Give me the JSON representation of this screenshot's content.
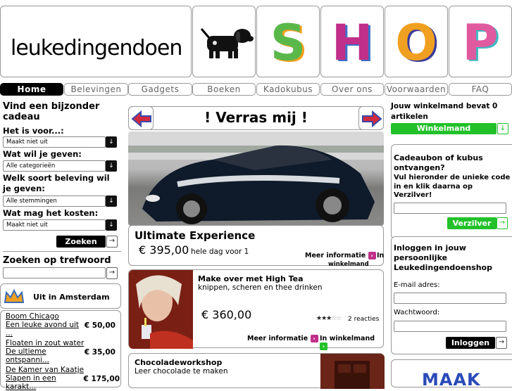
{
  "header": {
    "logo_text": "leukedingendoen",
    "shop_letters": [
      {
        "letter": "S",
        "color": "#5ab84a"
      },
      {
        "letter": "H",
        "color": "#c0308a"
      },
      {
        "letter": "O",
        "color": "#f0a020"
      },
      {
        "letter": "P",
        "color": "#e05aa0"
      }
    ]
  },
  "nav": [
    "Home",
    "Belevingen",
    "Gadgets",
    "Boeken",
    "Kadokubus",
    "Over ons",
    "Voorwaarden",
    "FAQ"
  ],
  "left": {
    "finder_title": "Vind een bijzonder cadeau",
    "q1_label": "Het is voor...:",
    "q1_value": "Maakt niet uit",
    "q2_label": "Wat wil je geven:",
    "q2_value": "Alle categorieën",
    "q3_label": "Welk soort beleving wil je geven:",
    "q3_value": "Alle stemmingen",
    "q4_label": "Wat mag het kosten:",
    "q4_value": "Maakt niet uit",
    "search_button": "Zoeken",
    "keyword_title": "Zoeken op trefwoord",
    "city_title": "Uit in Amsterdam",
    "city_items": [
      {
        "title": "Boom Chicago",
        "desc": "Een leuke avond uit ...",
        "price": "€ 50,00"
      },
      {
        "title": "Floaten in zout water",
        "desc": "De ultieme ontspanni...",
        "price": "€ 35,00"
      },
      {
        "title": "De Kamer van Kaatje",
        "desc": "Slapen in een karakt...",
        "price": "€ 175,00"
      }
    ]
  },
  "center": {
    "banner_title": "! Verras mij !",
    "featured": {
      "title": "Ultimate Experience",
      "price": "€ 395,00",
      "price_note": "hele dag voor 1",
      "more_info": "Meer informatie",
      "in_cart": "In",
      "in_cart_full": "winkelmand"
    },
    "products": [
      {
        "title": "Make over met High Tea",
        "subtitle": "knippen, scheren en thee drinken",
        "price": "€ 360,00",
        "rating": 3,
        "reviews": "2 reacties",
        "more_info": "Meer informatie",
        "in_cart": "In winkelmand"
      },
      {
        "title": "Chocoladeworkshop",
        "subtitle": "Leer chocolade te maken"
      }
    ]
  },
  "right": {
    "cart_text": "Jouw winkelmand bevat 0 artikelen",
    "cart_button": "Winkelmand",
    "voucher_title": "Cadeaubon of kubus ontvangen?",
    "voucher_text": "Vul hieronder de unieke code in en klik daarna op Verzilver!",
    "voucher_button": "Verzilver",
    "login_title": "Inloggen in jouw persoonlijke Leukedingendoenshop",
    "email_label": "E-mail adres:",
    "password_label": "Wachtwoord:",
    "login_button": "Inloggen",
    "promo_text": "MAAK"
  }
}
